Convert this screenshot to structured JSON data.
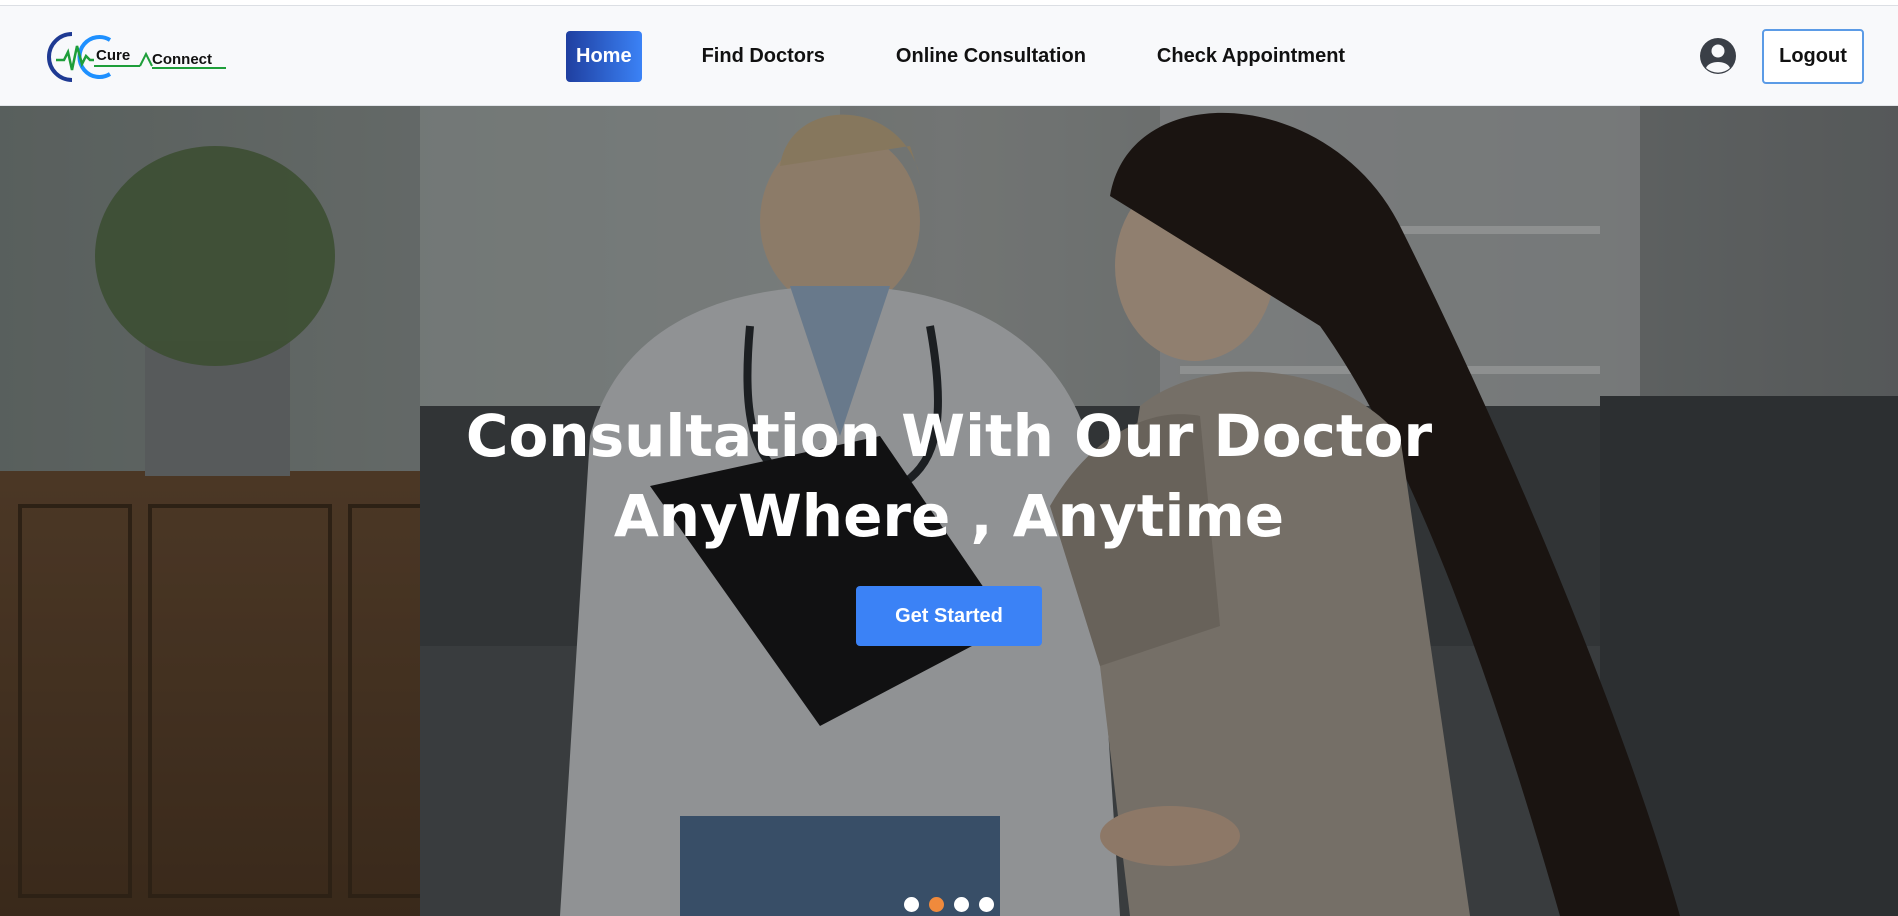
{
  "brand": {
    "logo_word_1": "Cure",
    "logo_word_2": "Connect",
    "colors": {
      "navy": "#1f3a93",
      "blue": "#1e90ff",
      "green": "#1e9e3a"
    }
  },
  "nav": {
    "items": [
      {
        "label": "Home",
        "active": true
      },
      {
        "label": "Find Doctors",
        "active": false
      },
      {
        "label": "Online Consultation",
        "active": false
      },
      {
        "label": "Check Appointment",
        "active": false
      }
    ],
    "profile_icon": "user-circle-icon",
    "logout_label": "Logout"
  },
  "hero": {
    "title_line_1": "Consultation With Our Doctor",
    "title_line_2": "AnyWhere , Anytime",
    "cta_label": "Get Started",
    "carousel": {
      "slides": 4,
      "active_index": 1,
      "active_color": "#f08a3c"
    }
  }
}
